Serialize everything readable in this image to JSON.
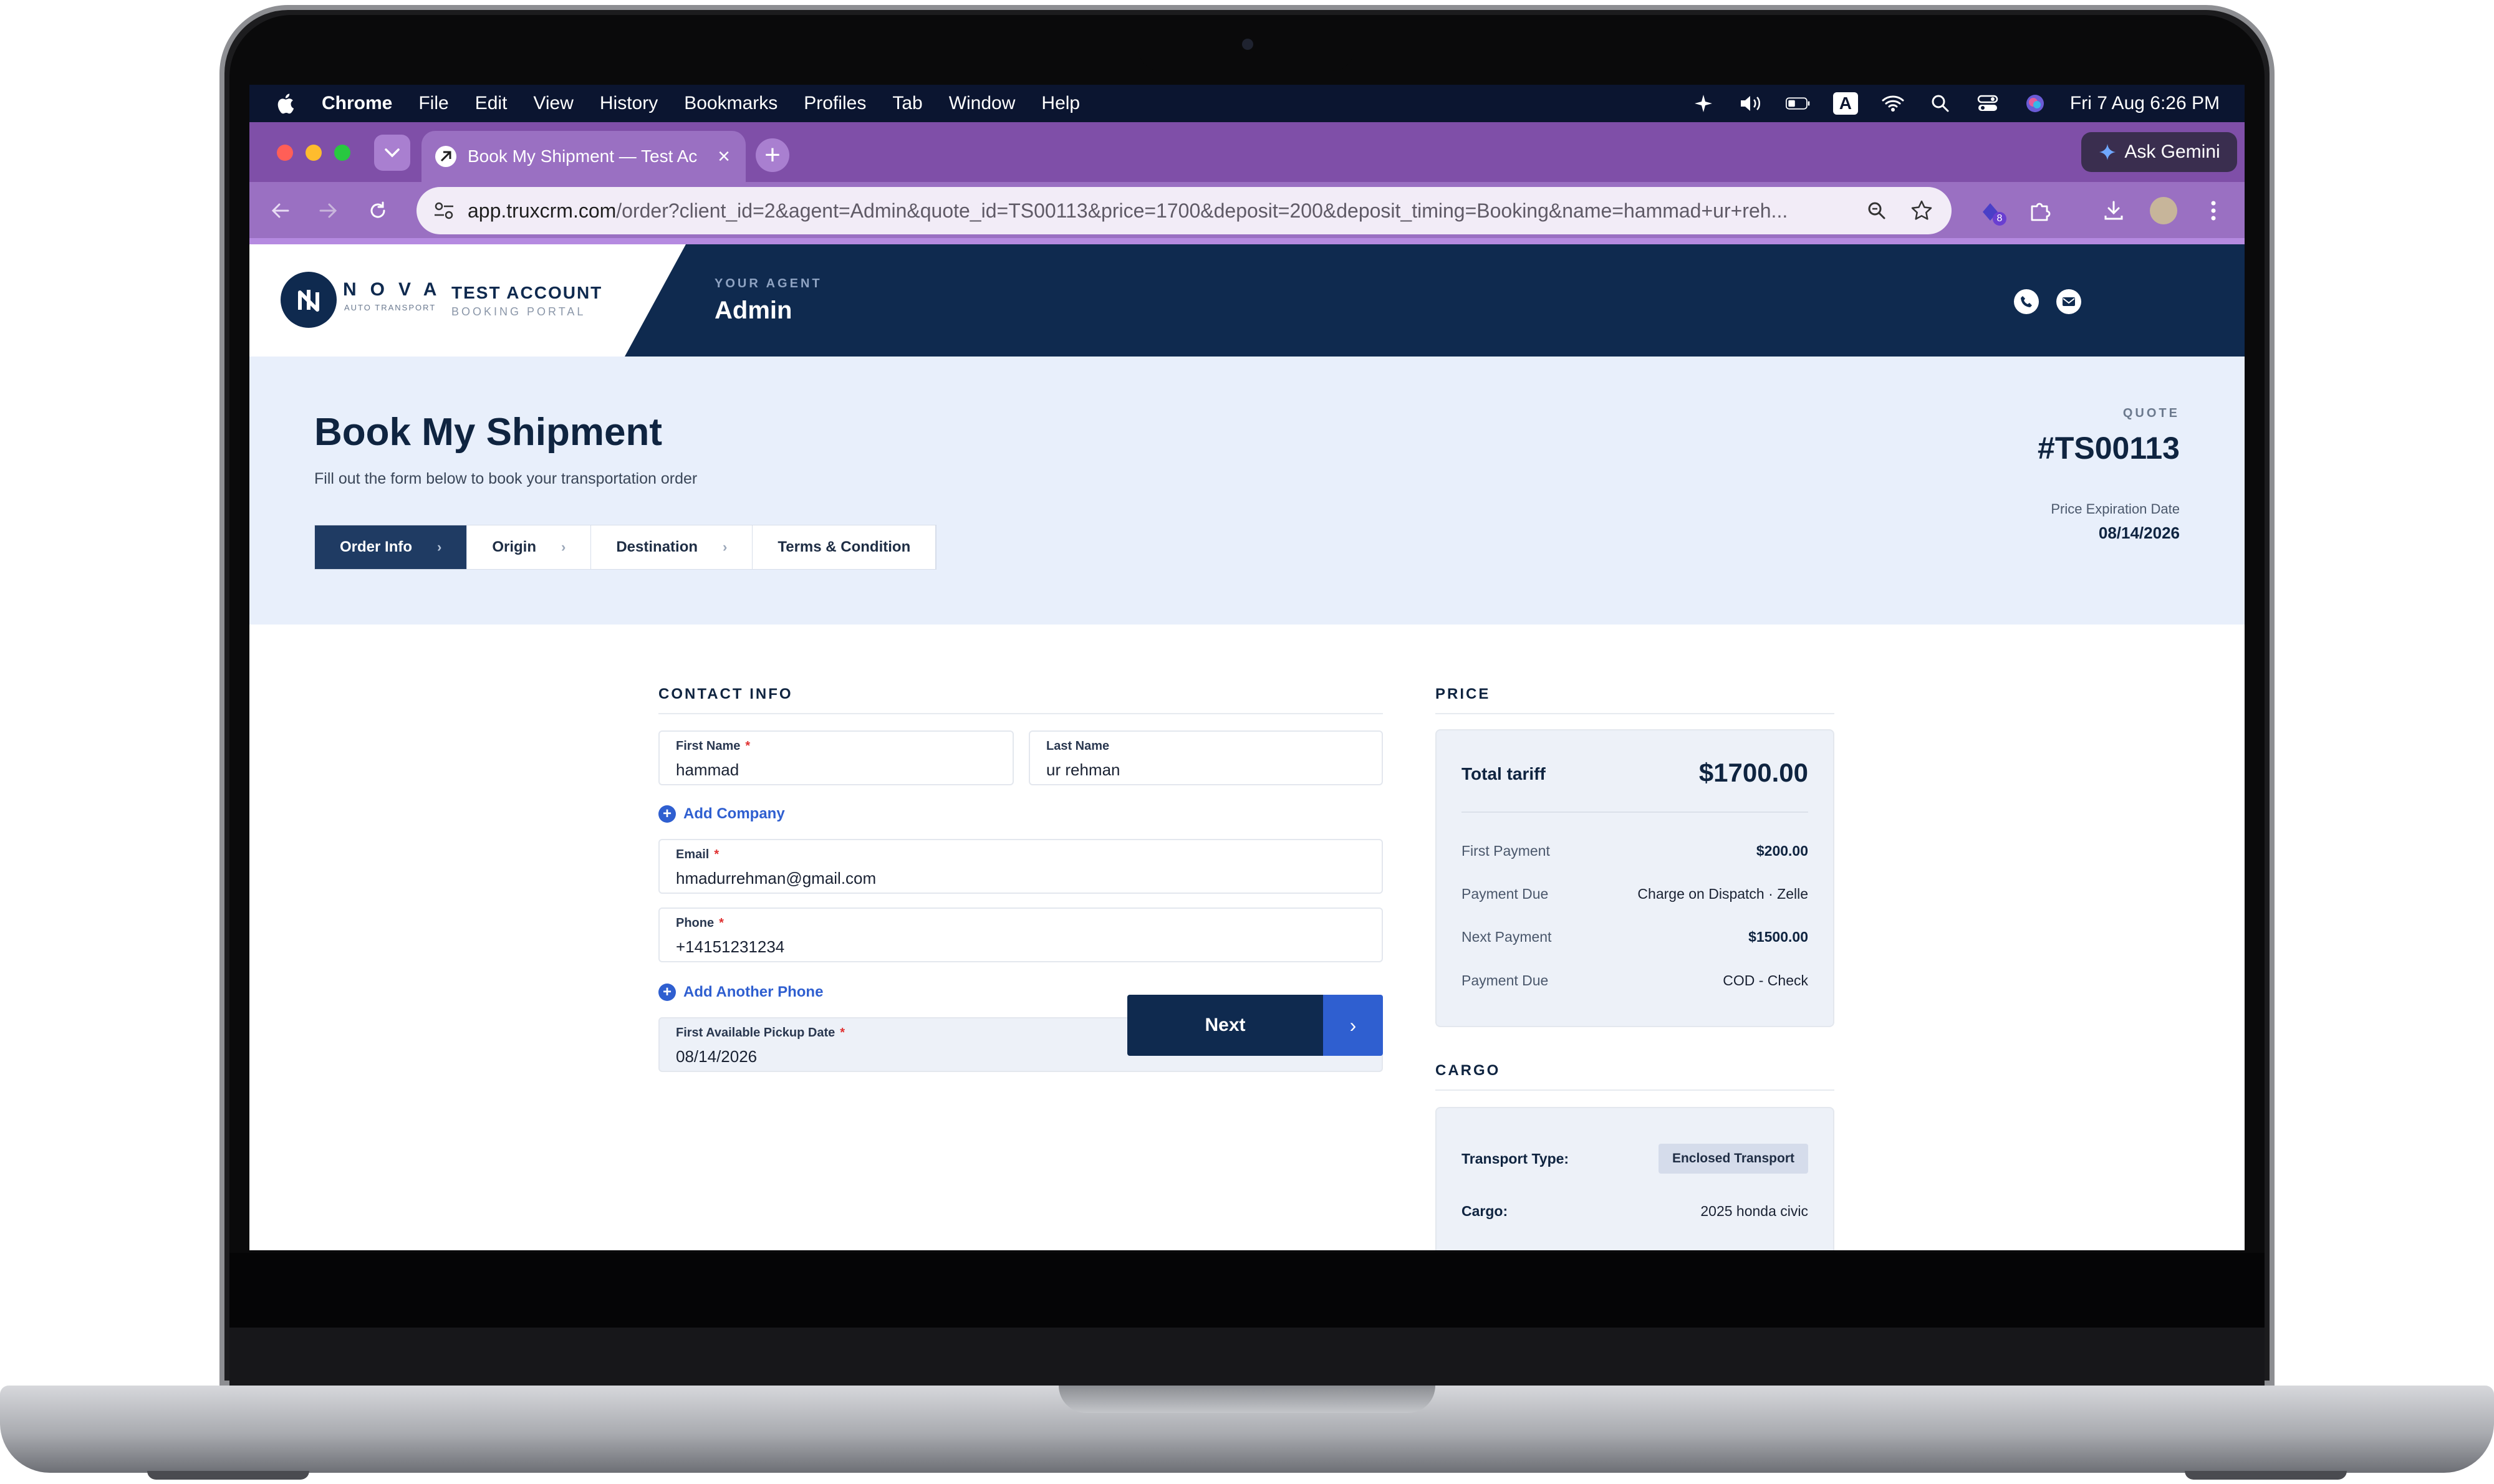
{
  "menubar": {
    "app": "Chrome",
    "items": [
      "File",
      "Edit",
      "View",
      "History",
      "Bookmarks",
      "Profiles",
      "Tab",
      "Window",
      "Help"
    ],
    "input_source": "A",
    "clock": "Fri 7 Aug  6:26 PM"
  },
  "browser": {
    "tab_title": "Book My Shipment — Test Ac",
    "new_tab": "+",
    "tab_close": "×",
    "ask_gemini": "Ask Gemini",
    "url_host": "app.truxcrm.com",
    "url_path": "/order?client_id=2&agent=Admin&quote_id=TS00113&price=1700&deposit=200&deposit_timing=Booking&name=hammad+ur+reh...",
    "extension_badge": "8"
  },
  "header": {
    "logo_name": "NOVA",
    "logo_sub": "AUTO TRANSPORT",
    "account_title": "TEST ACCOUNT",
    "account_sub": "BOOKING PORTAL",
    "agent_label": "YOUR AGENT",
    "agent_name": "Admin"
  },
  "hero": {
    "title": "Book My Shipment",
    "subtitle": "Fill out the form below to book your transportation order",
    "steps": [
      {
        "label": "Order Info",
        "active": true
      },
      {
        "label": "Origin",
        "active": false
      },
      {
        "label": "Destination",
        "active": false
      },
      {
        "label": "Terms & Condition",
        "active": false
      }
    ],
    "quote_label": "QUOTE",
    "quote_id": "#TS00113",
    "expiration_label": "Price Expiration Date",
    "expiration_date": "08/14/2026"
  },
  "contact": {
    "heading": "CONTACT INFO",
    "first_name_label": "First Name",
    "first_name": "hammad",
    "last_name_label": "Last Name",
    "last_name": "ur rehman",
    "add_company": "Add Company",
    "email_label": "Email",
    "email": "hmadurrehman@gmail.com",
    "phone_label": "Phone",
    "phone": "+14151231234",
    "add_phone": "Add Another Phone",
    "pickup_label": "First Available Pickup Date",
    "pickup_date": "08/14/2026",
    "next": "Next",
    "required_mark": "*"
  },
  "price": {
    "heading": "PRICE",
    "total_label": "Total tariff",
    "total": "$1700.00",
    "rows": [
      {
        "label": "First Payment",
        "value": "$200.00",
        "bold": true
      },
      {
        "label": "Payment Due",
        "value": "Charge on Dispatch · Zelle",
        "bold": false
      },
      {
        "label": "Next Payment",
        "value": "$1500.00",
        "bold": true
      },
      {
        "label": "Payment Due",
        "value": "COD - Check",
        "bold": false
      }
    ]
  },
  "cargo": {
    "heading": "CARGO",
    "transport_type_label": "Transport Type:",
    "transport_type": "Enclosed Transport",
    "cargo_label": "Cargo:",
    "cargo_value": "2025 honda civic"
  }
}
